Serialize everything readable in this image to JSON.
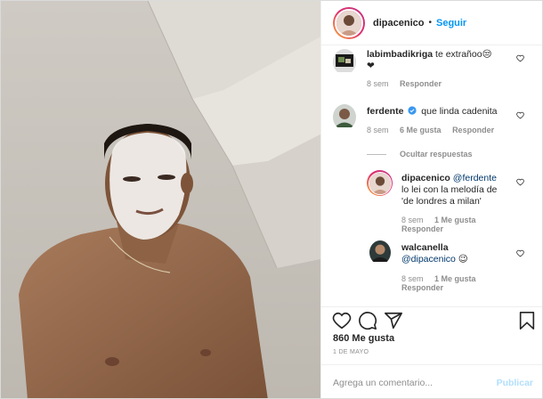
{
  "post": {
    "author": "dipacenico",
    "separator": "•",
    "follow_label": "Seguir"
  },
  "comments": [
    {
      "user": "labimbadikriga",
      "text": "te extrañoo😒",
      "text2": "❤",
      "age": "8 sem",
      "reply": "Responder"
    },
    {
      "user": "ferdente",
      "verified": true,
      "text": "que linda cadenita",
      "age": "8 sem",
      "likes": "6 Me gusta",
      "reply": "Responder"
    }
  ],
  "hide_replies_label": "Ocultar respuestas",
  "replies": [
    {
      "user": "dipacenico",
      "mention": "@ferdente",
      "line1_rest": "",
      "line2": "lo lei con la melodía de",
      "line3": "'de londres a milan'",
      "age": "8 sem",
      "likes": "1 Me gusta",
      "reply": "Responder"
    },
    {
      "user": "walcanella",
      "mention": "@dipacenico",
      "emoji": "😉",
      "age": "8 sem",
      "likes": "1 Me gusta",
      "reply": "Responder"
    }
  ],
  "actions": {
    "like_icon": "heart-icon",
    "comment_icon": "comment-icon",
    "share_icon": "share-icon",
    "save_icon": "bookmark-icon"
  },
  "likes_label": "860 Me gusta",
  "date_label": "1 DE MAYO",
  "add_comment": {
    "placeholder": "Agrega un comentario...",
    "publish_label": "Publicar"
  },
  "colors": {
    "accent": "#0095f6",
    "publish_disabled": "#b2dffc",
    "muted": "#8e8e8e",
    "verified": "#3897f0"
  }
}
